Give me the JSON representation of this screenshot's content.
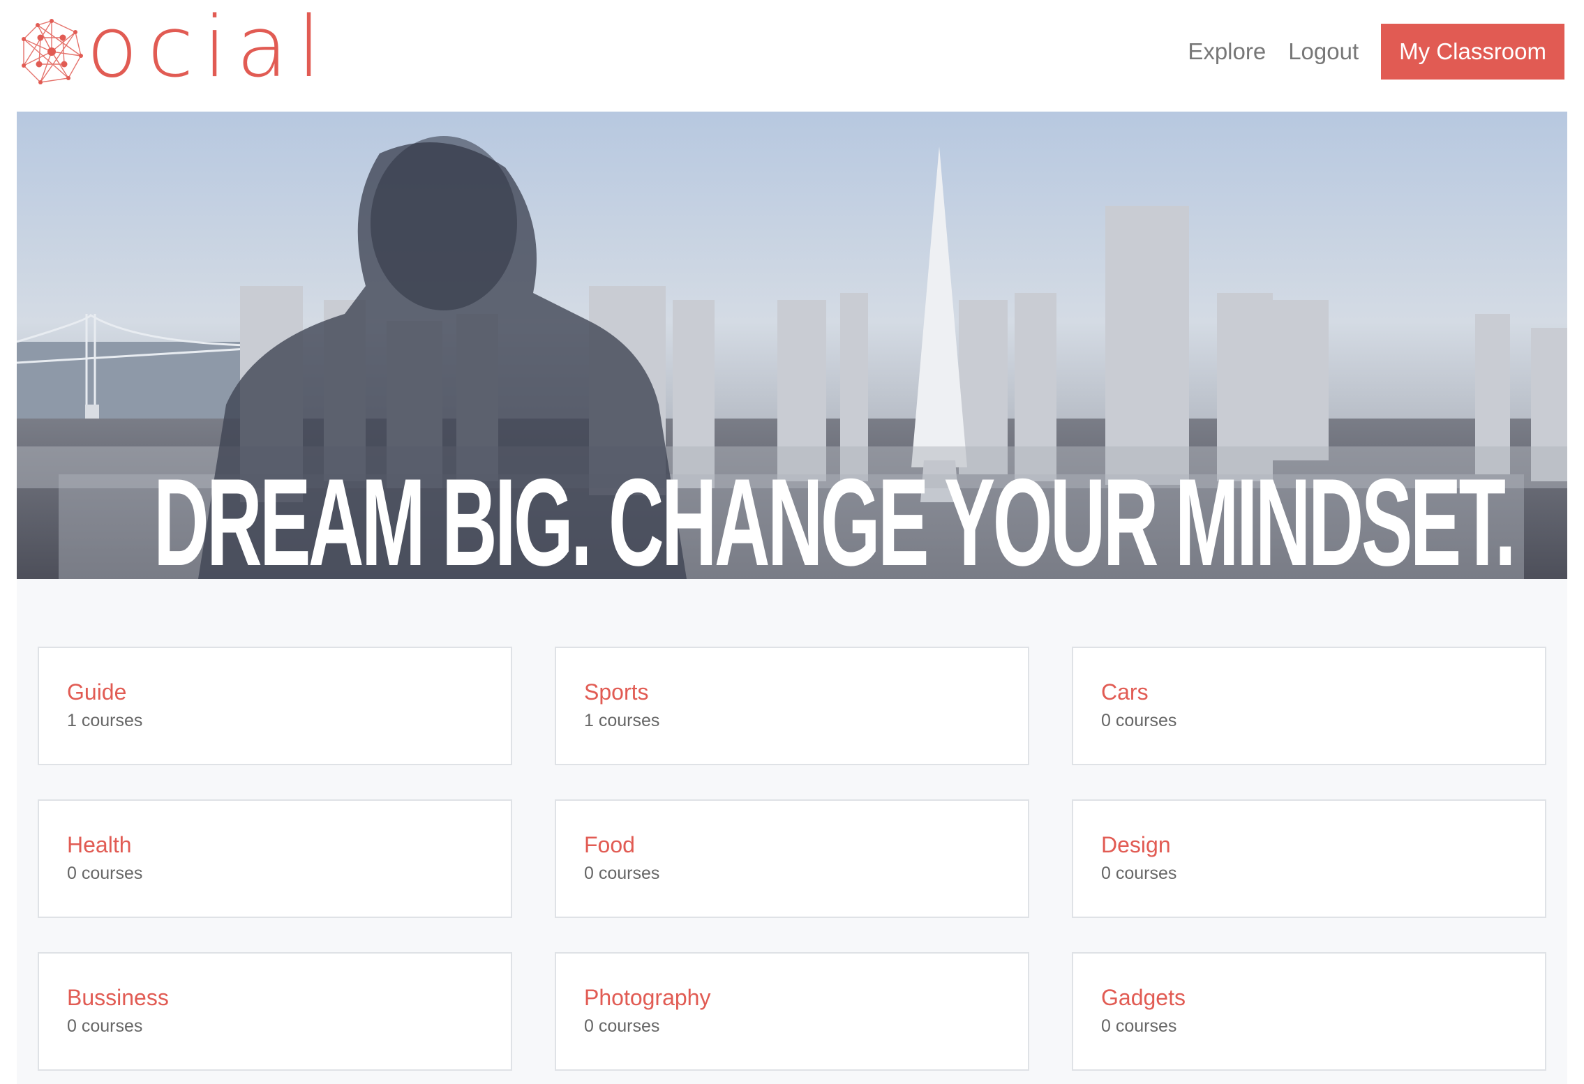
{
  "brand": {
    "logo_text": "ocial",
    "accent_color": "#e15b53"
  },
  "nav": {
    "links": [
      "Explore",
      "Logout"
    ],
    "cta_label": "My Classroom"
  },
  "hero": {
    "headline": "DREAM BIG. CHANGE YOUR MINDSET."
  },
  "categories": [
    {
      "name": "Guide",
      "count": "1 courses"
    },
    {
      "name": "Sports",
      "count": "1 courses"
    },
    {
      "name": "Cars",
      "count": "0 courses"
    },
    {
      "name": "Health",
      "count": "0 courses"
    },
    {
      "name": "Food",
      "count": "0 courses"
    },
    {
      "name": "Design",
      "count": "0 courses"
    },
    {
      "name": "Bussiness",
      "count": "0 courses"
    },
    {
      "name": "Photography",
      "count": "0 courses"
    },
    {
      "name": "Gadgets",
      "count": "0 courses"
    }
  ]
}
